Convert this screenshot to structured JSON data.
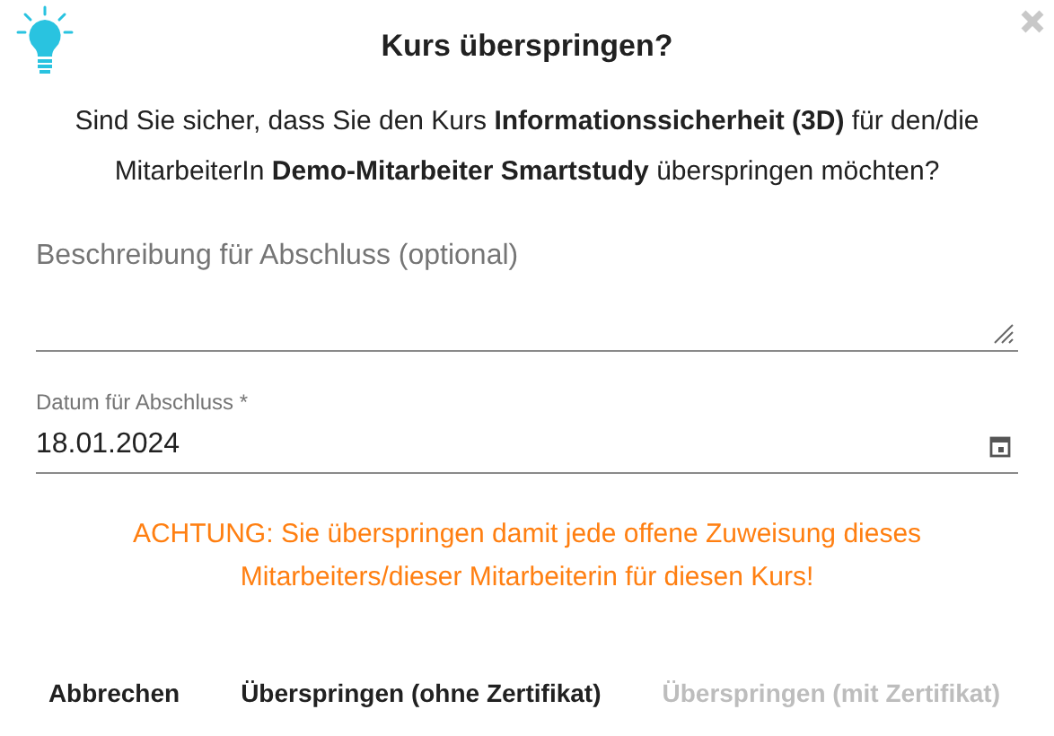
{
  "dialog": {
    "title": "Kurs überspringen?",
    "message": "Sind Sie sicher, dass Sie den Kurs **Informationssicherheit (3D)** für den/die MitarbeiterIn **Demo-Mitarbeiter Smartstudy** überspringen möchten?"
  },
  "description_field": {
    "placeholder": "Beschreibung für Abschluss (optional)"
  },
  "date_field": {
    "label": "Datum für Abschluss *",
    "value": "18.01.2024"
  },
  "warning": "ACHTUNG: Sie überspringen damit jede offene Zuweisung dieses Mitarbeiters/dieser Mitarbeiterin für diesen Kurs!",
  "buttons": [
    {
      "label": "Abbrechen",
      "disabled": false
    },
    {
      "label": "Überspringen (ohne Zertifikat)",
      "disabled": false
    },
    {
      "label": "Überspringen (mit Zertifikat)",
      "disabled": true
    }
  ]
}
